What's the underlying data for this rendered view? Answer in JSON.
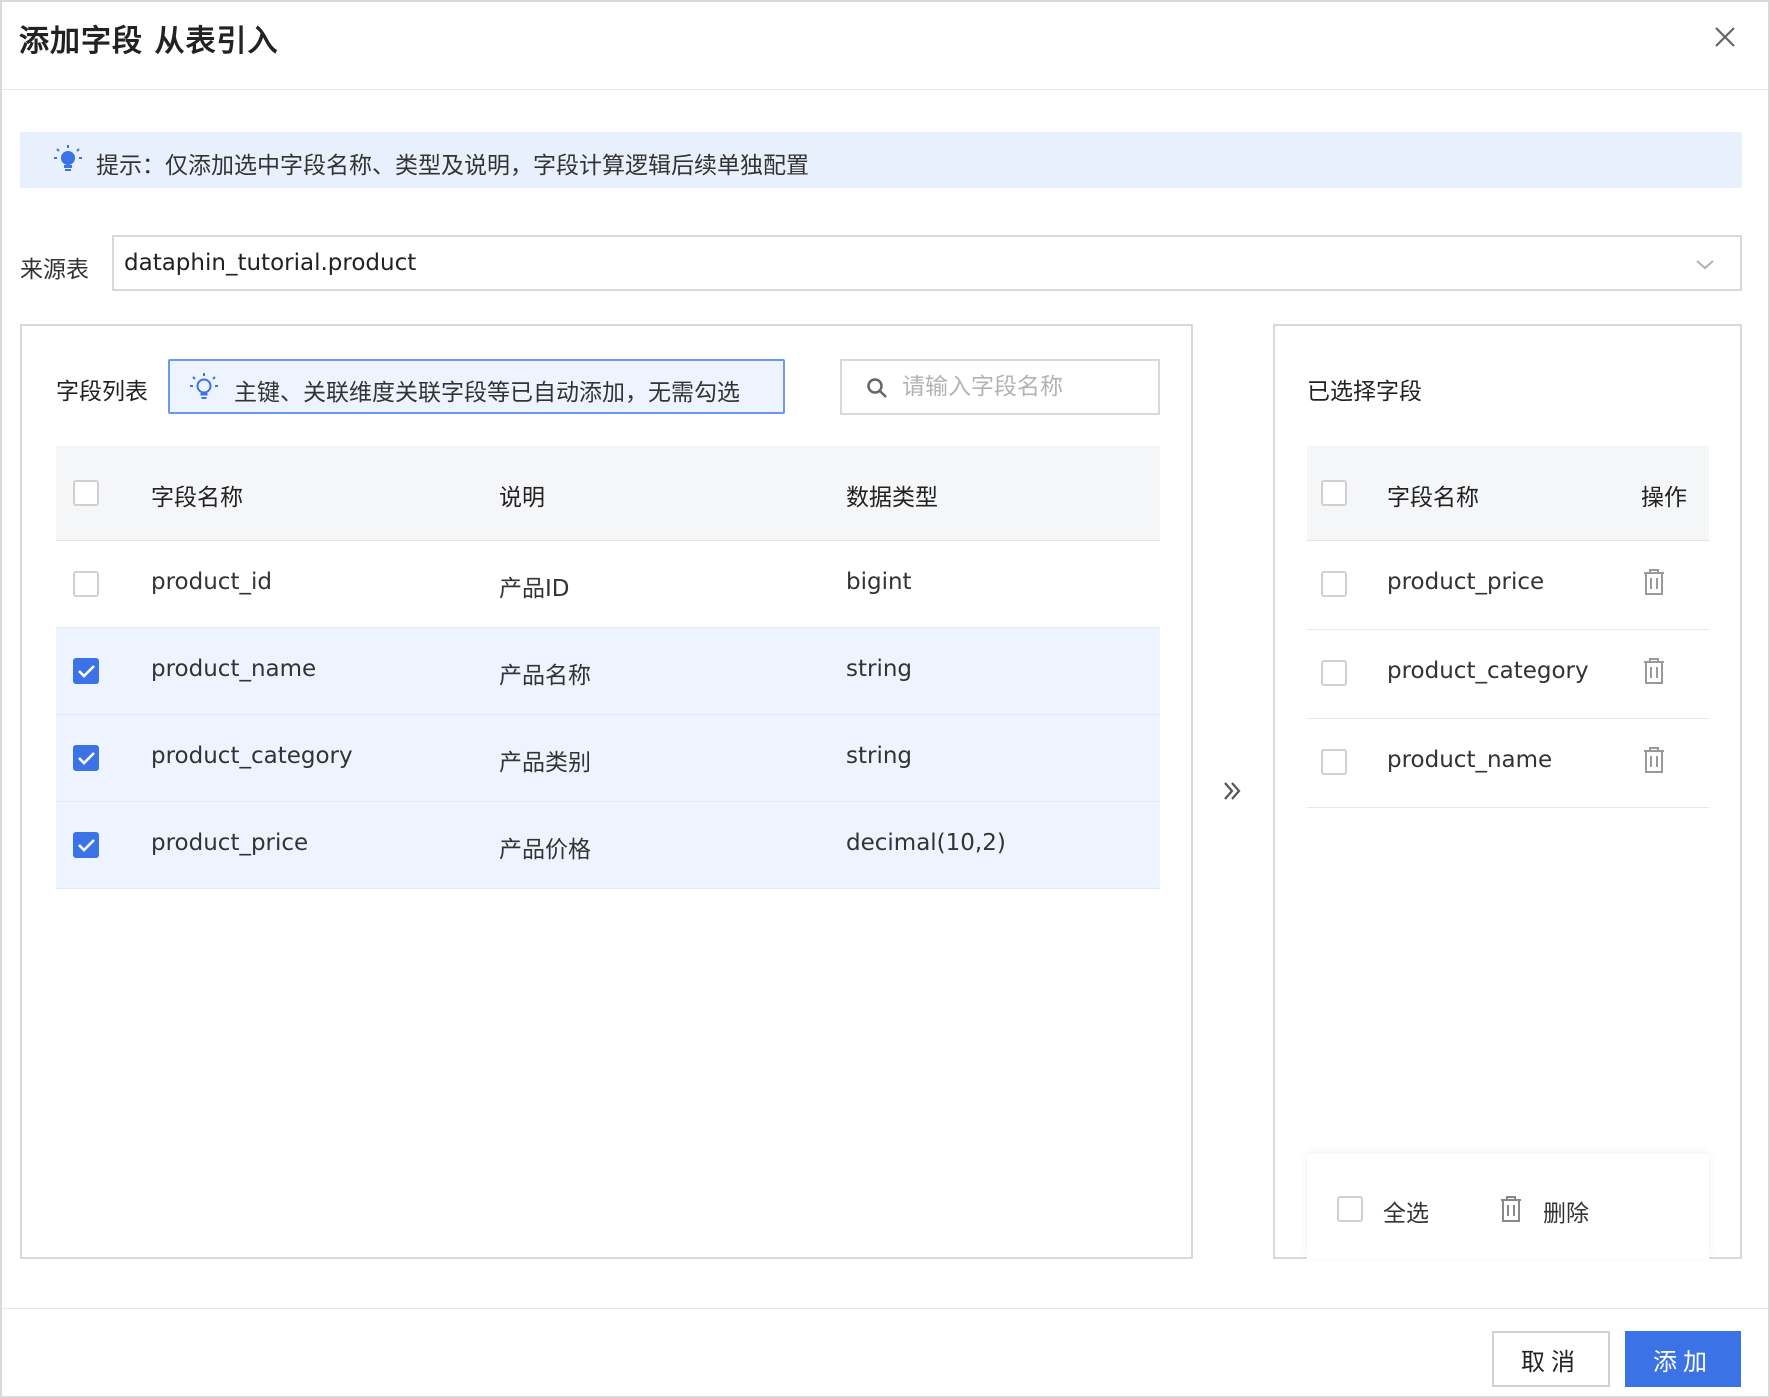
{
  "dialog": {
    "title": "添加字段 从表引入",
    "close_icon": "close-icon"
  },
  "tip": {
    "icon": "lightbulb-icon",
    "text": "提示：仅添加选中字段名称、类型及说明，字段计算逻辑后续单独配置"
  },
  "source": {
    "label": "来源表",
    "value": "dataphin_tutorial.product",
    "icon": "chevron-down-icon"
  },
  "field_list": {
    "title": "字段列表",
    "note": "主键、关联维度关联字段等已自动添加，无需勾选",
    "note_icon": "lightbulb-icon",
    "search_placeholder": "请输入字段名称",
    "columns": [
      "字段名称",
      "说明",
      "数据类型"
    ],
    "rows": [
      {
        "name": "product_id",
        "desc": "产品ID",
        "type": "bigint",
        "checked": false
      },
      {
        "name": "product_name",
        "desc": "产品名称",
        "type": "string",
        "checked": true
      },
      {
        "name": "product_category",
        "desc": "产品类别",
        "type": "string",
        "checked": true
      },
      {
        "name": "product_price",
        "desc": "产品价格",
        "type": "decimal(10,2)",
        "checked": true
      }
    ]
  },
  "transfer_icon": "double-chevron-right-icon",
  "selected": {
    "title": "已选择字段",
    "columns": [
      "字段名称",
      "操作"
    ],
    "rows": [
      {
        "name": "product_price"
      },
      {
        "name": "product_category"
      },
      {
        "name": "product_name"
      }
    ],
    "footer": {
      "select_all": "全选",
      "delete": "删除"
    }
  },
  "buttons": {
    "cancel": "取消",
    "add": "添加"
  },
  "colors": {
    "primary": "#3b73e6",
    "tip_bg": "#e8f0fd",
    "selected_row_bg": "#eef4ff",
    "border": "#d9d9d9"
  }
}
